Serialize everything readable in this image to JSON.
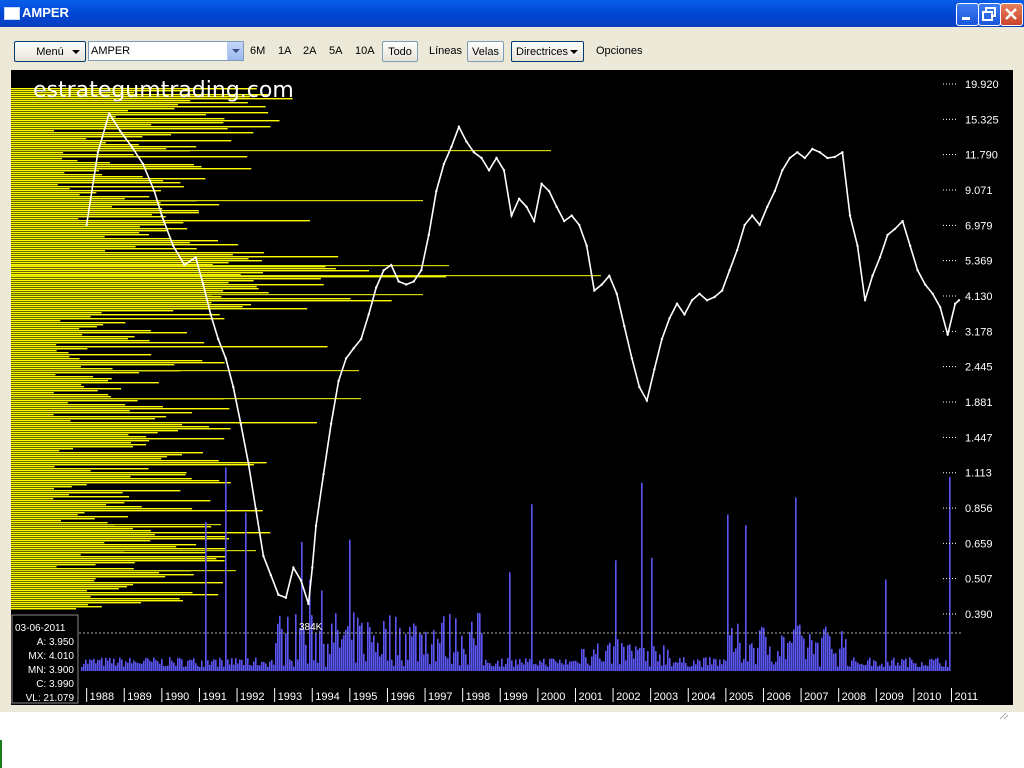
{
  "window": {
    "title": "AMPER",
    "minimize_label": "minimize",
    "maximize_label": "restore",
    "close_label": "close"
  },
  "toolbar": {
    "menu_label": "Menú",
    "symbol_value": "AMPER",
    "ranges": [
      "6M",
      "1A",
      "2A",
      "5A",
      "10A",
      "Todo"
    ],
    "active_range": "Todo",
    "lines_label": "Líneas",
    "candles_label": "Velas",
    "directrices_label": "Directrices",
    "options_label": "Opciones"
  },
  "watermark": "estrategumtrading.com",
  "info_box": {
    "date": "03-06-2011",
    "open": "A: 3.950",
    "high": "MX: 4.010",
    "low": "MN: 3.900",
    "close": "C: 3.990",
    "volume": "VL: 21.079"
  },
  "volume_marker": "384K",
  "colors": {
    "chart_bg": "#000000",
    "price_line": "#ffffff",
    "volume_profile": "#ffff00",
    "volume_bars": "#5b55f2",
    "axis_text": "#ffffff"
  },
  "chart_data": {
    "type": "line",
    "title": "",
    "y_scale": "log",
    "y_ticks": [
      "19.920",
      "15.325",
      "11.790",
      "9.071",
      "6.979",
      "5.369",
      "4.130",
      "3.178",
      "2.445",
      "1.881",
      "1.447",
      "1.113",
      "0.856",
      "0.659",
      "0.507",
      "0.390"
    ],
    "x_ticks": [
      "1988",
      "1989",
      "1990",
      "1991",
      "1992",
      "1993",
      "1994",
      "1995",
      "1996",
      "1997",
      "1998",
      "1999",
      "2000",
      "2001",
      "2002",
      "2003",
      "2004",
      "2005",
      "2006",
      "2007",
      "2008",
      "2009",
      "2010",
      "2011"
    ],
    "xlim": [
      1987.85,
      2011.2
    ],
    "series": [
      {
        "values_kind": "price_close_approx",
        "x": [
          1988.0,
          1988.3,
          1988.6,
          1988.9,
          1989.2,
          1989.5,
          1989.8,
          1990.0,
          1990.3,
          1990.6,
          1990.9,
          1991.1,
          1991.3,
          1991.5,
          1991.7,
          1991.9,
          1992.1,
          1992.3,
          1992.5,
          1992.7,
          1992.9,
          1993.1,
          1993.3,
          1993.5,
          1993.7,
          1993.9,
          1994.0,
          1994.1,
          1994.3,
          1994.5,
          1994.7,
          1994.9,
          1995.1,
          1995.3,
          1995.5,
          1995.7,
          1995.9,
          1996.1,
          1996.3,
          1996.5,
          1996.7,
          1996.9,
          1997.1,
          1997.3,
          1997.5,
          1997.7,
          1997.9,
          1998.1,
          1998.3,
          1998.5,
          1998.7,
          1998.9,
          1999.1,
          1999.3,
          1999.5,
          1999.7,
          1999.9,
          2000.1,
          2000.3,
          2000.5,
          2000.7,
          2000.9,
          2001.1,
          2001.3,
          2001.5,
          2001.7,
          2001.9,
          2002.1,
          2002.3,
          2002.5,
          2002.7,
          2002.9,
          2003.1,
          2003.3,
          2003.5,
          2003.7,
          2003.9,
          2004.1,
          2004.3,
          2004.5,
          2004.7,
          2004.9,
          2005.1,
          2005.3,
          2005.5,
          2005.7,
          2005.9,
          2006.1,
          2006.3,
          2006.5,
          2006.7,
          2006.9,
          2007.1,
          2007.3,
          2007.5,
          2007.7,
          2007.9,
          2008.1,
          2008.3,
          2008.5,
          2008.7,
          2008.9,
          2009.1,
          2009.3,
          2009.5,
          2009.7,
          2009.9,
          2010.1,
          2010.3,
          2010.5,
          2010.7,
          2010.9,
          2011.1,
          2011.2
        ],
        "y": [
          7.0,
          12.0,
          16.0,
          14.0,
          12.5,
          11.0,
          9.0,
          7.5,
          6.0,
          5.2,
          5.5,
          4.5,
          3.6,
          3.0,
          2.6,
          2.1,
          1.6,
          1.2,
          0.85,
          0.6,
          0.52,
          0.45,
          0.44,
          0.55,
          0.5,
          0.42,
          0.55,
          0.75,
          1.1,
          1.6,
          2.2,
          2.6,
          2.8,
          3.0,
          3.6,
          4.4,
          5.0,
          5.2,
          4.6,
          4.5,
          4.6,
          5.0,
          6.5,
          9.0,
          11.0,
          12.5,
          14.5,
          13.0,
          12.0,
          11.5,
          10.5,
          11.5,
          10.5,
          7.5,
          8.5,
          8.0,
          7.2,
          9.5,
          9.0,
          8.0,
          7.2,
          7.5,
          7.0,
          6.0,
          4.3,
          4.5,
          4.8,
          4.2,
          3.3,
          2.6,
          2.1,
          1.9,
          2.4,
          3.0,
          3.5,
          3.9,
          3.6,
          4.0,
          4.2,
          4.0,
          4.1,
          4.3,
          5.0,
          5.8,
          7.0,
          7.5,
          7.0,
          8.0,
          9.0,
          10.5,
          11.5,
          12.0,
          11.5,
          12.3,
          12.0,
          11.5,
          11.6,
          12.0,
          7.5,
          6.0,
          4.0,
          4.8,
          5.5,
          6.5,
          6.8,
          7.2,
          6.0,
          5.0,
          4.5,
          4.2,
          3.8,
          3.1,
          3.9,
          4.0
        ]
      }
    ],
    "volume_axis_marker_value": "384K"
  }
}
